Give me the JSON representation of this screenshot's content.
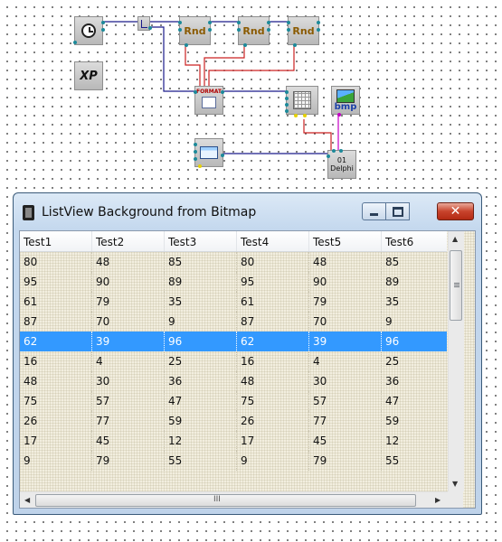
{
  "schema": {
    "components": {
      "timer_icon": "clock-icon",
      "xp_label": "XP",
      "rnd_labels": [
        "Rnd",
        "Rnd",
        "Rnd"
      ],
      "format_label": "FORMAT",
      "bmp_label": "bmp",
      "delphi_label": "Delphi",
      "delphi_counter": "01"
    },
    "colors": {
      "wire_blue": "#1a1a8a",
      "wire_red": "#cc2222",
      "wire_magenta": "#c400c4"
    }
  },
  "window": {
    "title": "ListView Background from Bitmap",
    "buttons": {
      "minimize_icon": "minimize-icon",
      "maximize_icon": "maximize-icon",
      "close": "✕"
    }
  },
  "listview": {
    "columns": [
      "Test1",
      "Test2",
      "Test3",
      "Test4",
      "Test5",
      "Test6"
    ],
    "selected_row": 4,
    "selection_color": "#3399ff",
    "rows": [
      [
        "80",
        "48",
        "85",
        "80",
        "48",
        "85"
      ],
      [
        "95",
        "90",
        "89",
        "95",
        "90",
        "89"
      ],
      [
        "61",
        "79",
        "35",
        "61",
        "79",
        "35"
      ],
      [
        "87",
        "70",
        "9",
        "87",
        "70",
        "9"
      ],
      [
        "62",
        "39",
        "96",
        "62",
        "39",
        "96"
      ],
      [
        "16",
        "4",
        "25",
        "16",
        "4",
        "25"
      ],
      [
        "48",
        "30",
        "36",
        "48",
        "30",
        "36"
      ],
      [
        "75",
        "57",
        "47",
        "75",
        "57",
        "47"
      ],
      [
        "26",
        "77",
        "59",
        "26",
        "77",
        "59"
      ],
      [
        "17",
        "45",
        "12",
        "17",
        "45",
        "12"
      ],
      [
        "9",
        "79",
        "55",
        "9",
        "79",
        "55"
      ]
    ],
    "hscroll_grip": "III"
  }
}
